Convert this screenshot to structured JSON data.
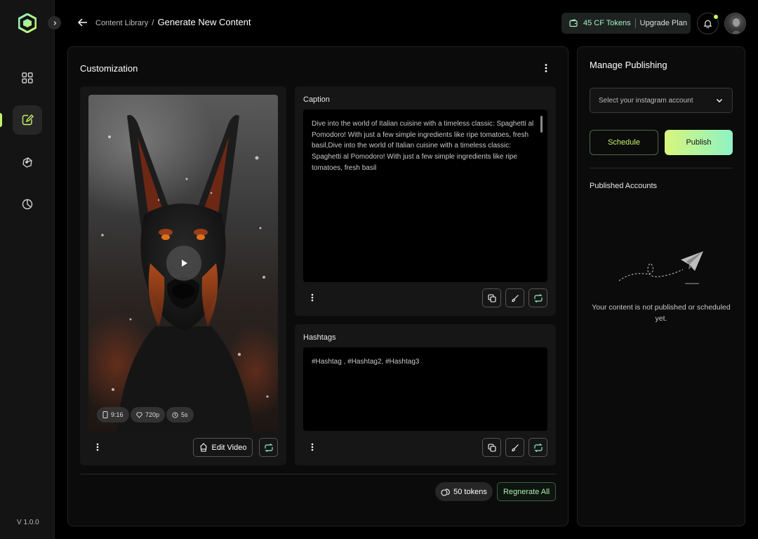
{
  "app": {
    "version": "V 1.0.0",
    "accent_color": "#c6f36a",
    "background": "#000000"
  },
  "sidebar": {
    "items": [
      {
        "icon": "grid-icon",
        "active": false
      },
      {
        "icon": "edit-note-icon",
        "active": true
      },
      {
        "icon": "brain-icon",
        "active": false
      },
      {
        "icon": "pie-chart-icon",
        "active": false
      }
    ]
  },
  "header": {
    "breadcrumb_parent": "Content Library",
    "breadcrumb_separator": "/",
    "title": "Generate New Content",
    "tokens_label": "45 CF Tokens",
    "upgrade_label": "Upgrade Plan"
  },
  "customization": {
    "title": "Customization",
    "video": {
      "aspect": "9:16",
      "resolution": "720p",
      "duration": "5s",
      "edit_label": "Edit Video"
    },
    "caption": {
      "label": "Caption",
      "text": "Dive into the world of Italian cuisine with a timeless classic: Spaghetti al Pomodoro! With just a few simple ingredients like ripe tomatoes, fresh basil,Dive into the world of Italian cuisine with a timeless classic: Spaghetti al Pomodoro! With just a few simple ingredients like ripe tomatoes, fresh basil"
    },
    "hashtags": {
      "label": "Hashtags",
      "text": "#Hashtag , #Hashtag2, #Hashtag3"
    },
    "tokens_cost": "50 tokens",
    "regenerate_label": "Regnerate All"
  },
  "publishing": {
    "title": "Manage Publishing",
    "account_placeholder": "Select your instagram account",
    "schedule_label": "Schedule",
    "publish_label": "Publish",
    "published_accounts_label": "Published Accounts",
    "empty_message": "Your content is not published or scheduled yet."
  }
}
